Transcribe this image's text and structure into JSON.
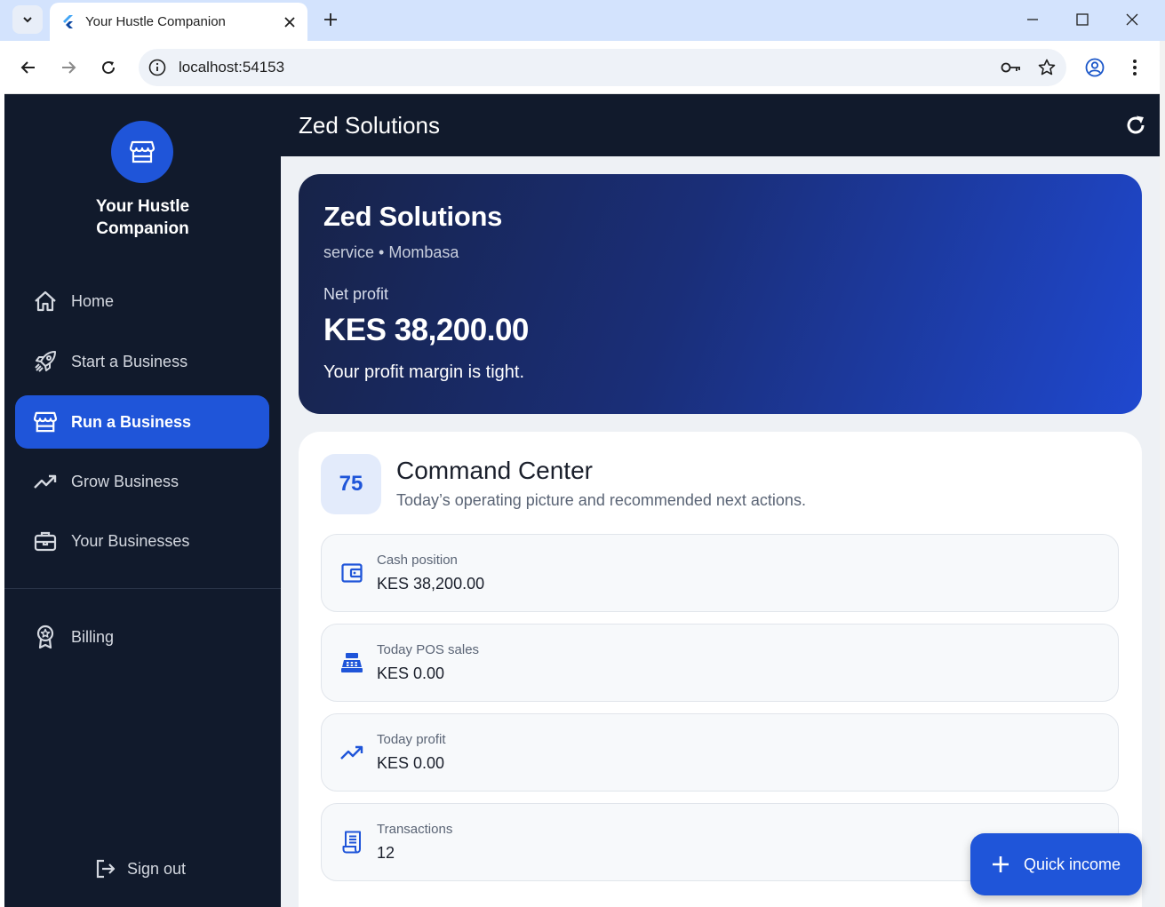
{
  "browser": {
    "tab_title": "Your Hustle Companion",
    "url": "localhost:54153"
  },
  "sidebar": {
    "brand_name": "Your Hustle Companion",
    "items": [
      {
        "label": "Home",
        "icon": "home-icon"
      },
      {
        "label": "Start a Business",
        "icon": "rocket-icon"
      },
      {
        "label": "Run a Business",
        "icon": "storefront-icon",
        "active": true
      },
      {
        "label": "Grow Business",
        "icon": "trending-up-icon"
      },
      {
        "label": "Your Businesses",
        "icon": "briefcase-icon"
      },
      {
        "label": "Billing",
        "icon": "badge-icon"
      }
    ],
    "sign_out": "Sign out"
  },
  "appbar": {
    "title": "Zed Solutions"
  },
  "hero": {
    "title": "Zed Solutions",
    "subtitle": "service • Mombasa",
    "label": "Net profit",
    "value": "KES 38,200.00",
    "note": "Your profit margin is tight."
  },
  "command_center": {
    "score": "75",
    "title": "Command Center",
    "subtitle": "Today’s operating picture and recommended next actions.",
    "metrics": [
      {
        "label": "Cash position",
        "value": "KES 38,200.00",
        "icon": "wallet-icon"
      },
      {
        "label": "Today POS sales",
        "value": "KES 0.00",
        "icon": "cash-register-icon"
      },
      {
        "label": "Today profit",
        "value": "KES 0.00",
        "icon": "trending-up-icon"
      },
      {
        "label": "Transactions",
        "value": "12",
        "icon": "receipt-icon"
      }
    ]
  },
  "fab": {
    "label": "Quick income"
  },
  "colors": {
    "sidebar_bg": "#111a2c",
    "accent": "#1f55d9",
    "main_bg": "#eef1f5"
  }
}
